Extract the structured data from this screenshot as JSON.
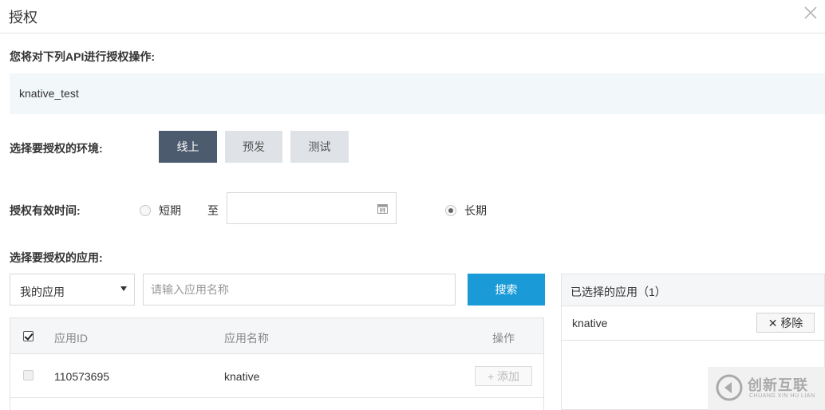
{
  "dialog": {
    "title": "授权",
    "close_icon": "close-icon"
  },
  "api_section": {
    "label": "您将对下列API进行授权操作:",
    "api_name": "knative_test"
  },
  "env_section": {
    "label": "选择要授权的环境:",
    "options": [
      {
        "label": "线上",
        "active": true
      },
      {
        "label": "预发",
        "active": false
      },
      {
        "label": "测试",
        "active": false
      }
    ]
  },
  "validity_section": {
    "label": "授权有效时间:",
    "short_label": "短期",
    "to_label": "至",
    "date_value": "",
    "long_label": "长期",
    "selected": "long"
  },
  "app_section": {
    "label": "选择要授权的应用:",
    "app_select": "我的应用",
    "search_placeholder": "请输入应用名称",
    "search_button": "搜索",
    "table": {
      "headers": {
        "id": "应用ID",
        "name": "应用名称",
        "action": "操作"
      },
      "rows": [
        {
          "id": "110573695",
          "name": "knative",
          "action_label": "添加"
        }
      ]
    },
    "selected_panel": {
      "title": "已选择的应用（1）",
      "items": [
        {
          "name": "knative",
          "remove_label": "移除"
        }
      ]
    }
  },
  "watermark": {
    "text": "创新互联",
    "sub": "CHUANG XIN HU LIAN"
  },
  "colors": {
    "accent": "#1a9ad6",
    "env_active": "#4d5b6e",
    "env_inactive": "#dfe3e8"
  }
}
